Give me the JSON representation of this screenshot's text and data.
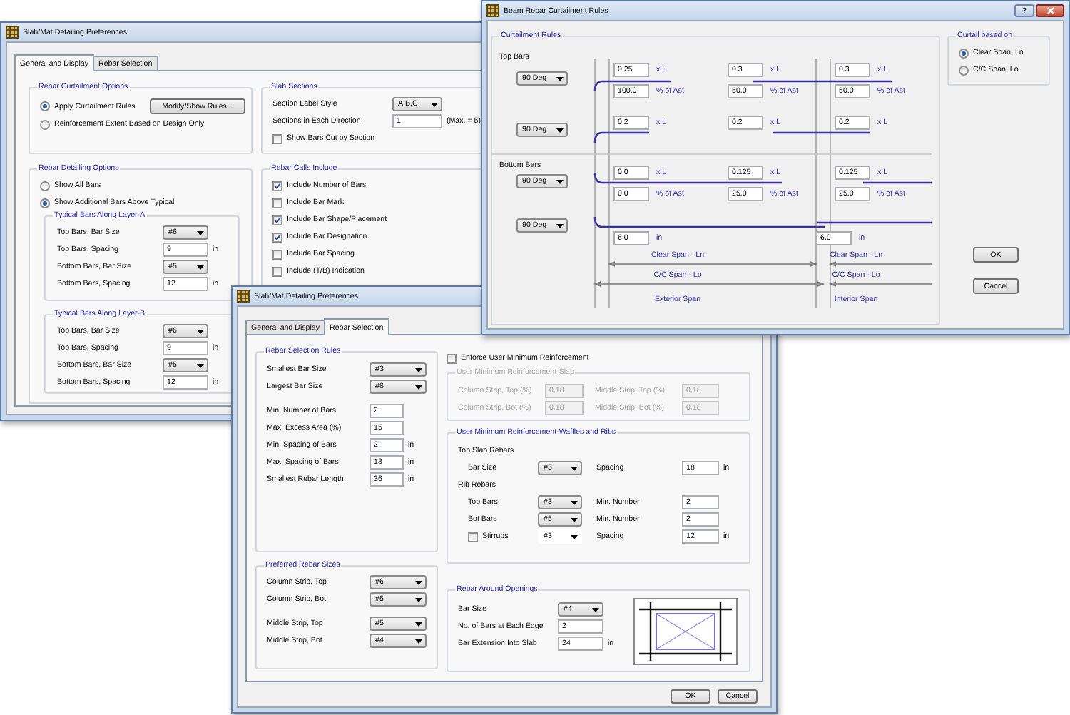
{
  "general_window": {
    "title": "Slab/Mat Detailing Preferences",
    "tabs": [
      {
        "label": "General and Display",
        "selected": true
      },
      {
        "label": "Rebar Selection",
        "selected": false
      }
    ],
    "curtailment_options": {
      "title": "Rebar Curtailment Options",
      "options": [
        {
          "label": "Apply Curtailment Rules",
          "selected": true
        },
        {
          "label": "Reinforcement Extent Based on Design Only",
          "selected": false
        }
      ],
      "button": "Modify/Show Rules..."
    },
    "slab_sections": {
      "title": "Slab Sections",
      "rows": [
        {
          "kind": "dropdown",
          "label": "Section Label Style",
          "value": "A,B,C"
        },
        {
          "kind": "field",
          "label": "Sections in Each Direction",
          "value": "1",
          "unit": "(Max. = 5)"
        }
      ],
      "show_bars_cut": {
        "label": "Show Bars Cut by Section",
        "checked": false
      }
    },
    "detailing_options": {
      "title": "Rebar Detailing Options",
      "options": [
        {
          "label": "Show All Bars",
          "selected": false
        },
        {
          "label": "Show Additional Bars Above Typical",
          "selected": true
        }
      ],
      "layers": [
        {
          "title": "Typical Bars Along Layer-A",
          "rows": [
            {
              "kind": "dropdown",
              "label": "Top Bars, Bar Size",
              "value": "#6"
            },
            {
              "kind": "field",
              "label": "Top Bars, Spacing",
              "value": "9",
              "unit": "in"
            },
            {
              "kind": "dropdown",
              "label": "Bottom Bars, Bar Size",
              "value": "#5"
            },
            {
              "kind": "field",
              "label": "Bottom Bars, Spacing",
              "value": "12",
              "unit": "in"
            }
          ]
        },
        {
          "title": "Typical Bars Along Layer-B",
          "rows": [
            {
              "kind": "dropdown",
              "label": "Top Bars, Bar Size",
              "value": "#6"
            },
            {
              "kind": "field",
              "label": "Top Bars, Spacing",
              "value": "9",
              "unit": "in"
            },
            {
              "kind": "dropdown",
              "label": "Bottom Bars, Bar Size",
              "value": "#5"
            },
            {
              "kind": "field",
              "label": "Bottom Bars, Spacing",
              "value": "12",
              "unit": "in"
            }
          ]
        }
      ]
    },
    "calls_include": {
      "title": "Rebar Calls Include",
      "items": [
        {
          "label": "Include Number of Bars",
          "checked": true
        },
        {
          "label": "Include Bar Mark",
          "checked": false
        },
        {
          "label": "Include Bar Shape/Placement",
          "checked": true
        },
        {
          "label": "Include Bar Designation",
          "checked": true
        },
        {
          "label": "Include Bar Spacing",
          "checked": false
        },
        {
          "label": "Include (T/B) Indication",
          "checked": false
        }
      ]
    }
  },
  "curtailment_window": {
    "title": "Beam Rebar Curtailment Rules",
    "help_button": "?",
    "rules": {
      "title": "Curtailment Rules",
      "sections": [
        {
          "label": "Top Bars",
          "rows": [
            {
              "hook": "90 Deg",
              "length": [
                {
                  "value": "0.25",
                  "unit": "x L"
                },
                {
                  "value": "0.3",
                  "unit": "x L"
                },
                {
                  "value": "0.3",
                  "unit": "x L"
                }
              ],
              "percent": [
                {
                  "value": "100.0",
                  "unit": "% of Ast"
                },
                {
                  "value": "50.0",
                  "unit": "% of Ast"
                },
                {
                  "value": "50.0",
                  "unit": "% of Ast"
                }
              ]
            },
            {
              "hook": "90 Deg",
              "length": [
                {
                  "value": "0.2",
                  "unit": "x L"
                },
                {
                  "value": "0.2",
                  "unit": "x L"
                },
                {
                  "value": "0.2",
                  "unit": "x L"
                }
              ]
            }
          ]
        },
        {
          "label": "Bottom Bars",
          "rows": [
            {
              "hook": "90 Deg",
              "length": [
                {
                  "value": "0.0",
                  "unit": "x L"
                },
                {
                  "value": "0.125",
                  "unit": "x L"
                },
                {
                  "value": "0.125",
                  "unit": "x L"
                }
              ],
              "percent": [
                {
                  "value": "0.0",
                  "unit": "% of Ast"
                },
                {
                  "value": "25.0",
                  "unit": "% of Ast"
                },
                {
                  "value": "25.0",
                  "unit": "% of Ast"
                }
              ]
            },
            {
              "hook": "90 Deg",
              "extension": [
                {
                  "value": "6.0",
                  "unit": "in"
                },
                {
                  "value": "6.0",
                  "unit": "in"
                }
              ]
            }
          ]
        }
      ],
      "spans": [
        {
          "clear": "Clear Span - Ln",
          "cc": "C/C Span - Lo",
          "name": "Exterior Span"
        },
        {
          "clear": "Clear Span - Ln",
          "cc": "C/C Span - Lo",
          "name": "Interior Span"
        }
      ]
    },
    "curtail_based_on": {
      "title": "Curtail based on",
      "options": [
        {
          "label": "Clear Span, Ln",
          "selected": true
        },
        {
          "label": "C/C Span, Lo",
          "selected": false
        }
      ]
    },
    "buttons": [
      "OK",
      "Cancel"
    ]
  },
  "selection_window": {
    "title": "Slab/Mat Detailing Preferences",
    "tabs": [
      {
        "label": "General and Display",
        "selected": false
      },
      {
        "label": "Rebar Selection",
        "selected": true
      }
    ],
    "selection_rules": {
      "title": "Rebar Selection Rules",
      "row_groups": [
        {
          "rows": [
            {
              "kind": "dropdown",
              "label": "Smallest Bar Size",
              "value": "#3"
            },
            {
              "kind": "dropdown",
              "label": "Largest Bar Size",
              "value": "#8"
            }
          ]
        },
        {
          "rows": [
            {
              "kind": "field",
              "label": "Min. Number of Bars",
              "value": "2"
            },
            {
              "kind": "field",
              "label": "Max. Excess Area (%)",
              "value": "15"
            },
            {
              "kind": "field",
              "label": "Min. Spacing of Bars",
              "value": "2",
              "unit": "in"
            },
            {
              "kind": "field",
              "label": "Max. Spacing of Bars",
              "value": "18",
              "unit": "in"
            },
            {
              "kind": "field",
              "label": "Smallest Rebar Length",
              "value": "36",
              "unit": "in"
            }
          ]
        }
      ]
    },
    "preferred_sizes": {
      "title": "Preferred Rebar Sizes",
      "row_groups": [
        {
          "rows": [
            {
              "kind": "dropdown",
              "label": "Column Strip, Top",
              "value": "#6"
            },
            {
              "kind": "dropdown",
              "label": "Column Strip, Bot",
              "value": "#5"
            }
          ]
        },
        {
          "rows": [
            {
              "kind": "dropdown",
              "label": "Middle Strip, Top",
              "value": "#5"
            },
            {
              "kind": "dropdown",
              "label": "Middle Strip, Bot",
              "value": "#4"
            }
          ]
        }
      ]
    },
    "enforce_minimum": {
      "label": "Enforce User Minimum Reinforcement",
      "checked": false
    },
    "slab_minimum": {
      "title": "User Minimum Reinforcement-Slab",
      "disabled": true,
      "rows": [
        {
          "label": "Column Strip, Top (%)",
          "value": "0.18",
          "other_label": "Middle Strip, Top (%)",
          "other_value": "0.18"
        },
        {
          "label": "Column Strip, Bot (%)",
          "value": "0.18",
          "other_label": "Middle Strip, Bot (%)",
          "other_value": "0.18"
        }
      ]
    },
    "waffle_minimum": {
      "title": "User Minimum Reinforcement-Waffles and Ribs",
      "groups": [
        {
          "label": "Top Slab Rebars",
          "rows": [
            {
              "kind": "plain",
              "label": "Bar Size",
              "value": "#3",
              "other_label": "Spacing",
              "other_value": "18",
              "unit": "in"
            }
          ]
        },
        {
          "label": "Rib Rebars",
          "rows": [
            {
              "kind": "plain",
              "label": "Top Bars",
              "value": "#3",
              "other_label": "Min. Number",
              "other_value": "2"
            },
            {
              "kind": "plain",
              "label": "Bot Bars",
              "value": "#5",
              "other_label": "Min. Number",
              "other_value": "2"
            },
            {
              "kind": "checkbox",
              "label": "Stirrups",
              "checked": false,
              "value": "#3",
              "other_label": "Spacing",
              "other_value": "12",
              "unit": "in"
            }
          ]
        }
      ]
    },
    "openings": {
      "title": "Rebar Around Openings",
      "rows": [
        {
          "kind": "dropdown",
          "label": "Bar Size",
          "value": "#4"
        },
        {
          "kind": "field",
          "label": "No. of Bars at Each Edge",
          "value": "2"
        },
        {
          "kind": "field",
          "label": "Bar Extension Into Slab",
          "value": "24",
          "unit": "in"
        }
      ]
    },
    "buttons": [
      "OK",
      "Cancel"
    ]
  }
}
